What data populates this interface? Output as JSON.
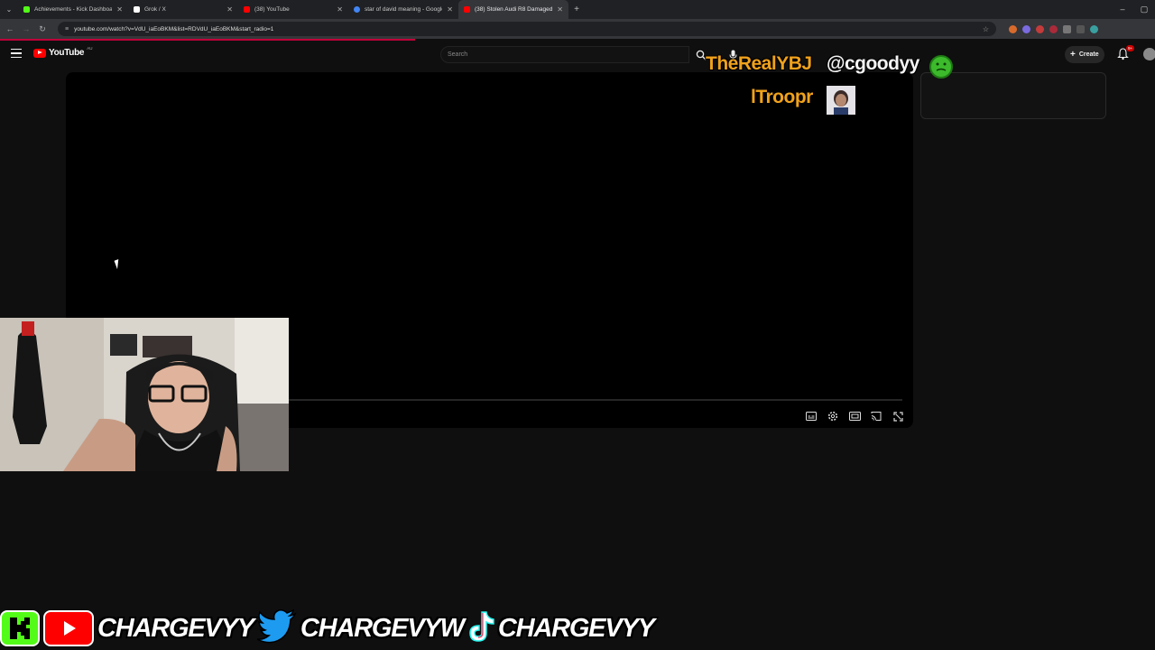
{
  "browser": {
    "tabs": [
      {
        "title": "Achievements - Kick Dashboard",
        "favicon_color": "#53fc18",
        "active": false
      },
      {
        "title": "Grok / X",
        "favicon_color": "#ffffff",
        "active": false
      },
      {
        "title": "(38) YouTube",
        "favicon_color": "#ff0000",
        "active": false
      },
      {
        "title": "star of david meaning - Google",
        "favicon_color": "#4285f4",
        "active": false
      },
      {
        "title": "(38) Stolen Audi R8 Damaged",
        "favicon_color": "#ff0000",
        "active": true
      }
    ],
    "url": "youtube.com/watch?v=VdU_iaEoBKM&list=RDVdU_iaEoBKM&start_radio=1"
  },
  "youtube": {
    "logo_text": "YouTube",
    "country_code": "AU",
    "search_placeholder": "Search",
    "create_label": "Create",
    "notification_count": "9+"
  },
  "overlay": {
    "name1": "TheRealYBJ",
    "handle": "@cgoodyy",
    "name2": "lTroopr"
  },
  "socials": {
    "youtube": "CHARGEVYY",
    "twitter": "CHARGEVYW",
    "tiktok": "CHARGEVYY"
  },
  "colors": {
    "accent_red": "#ff0000",
    "overlay_gold": "#f0a21c",
    "kick_green": "#53fc18",
    "twitter_blue": "#1d9bf0"
  }
}
